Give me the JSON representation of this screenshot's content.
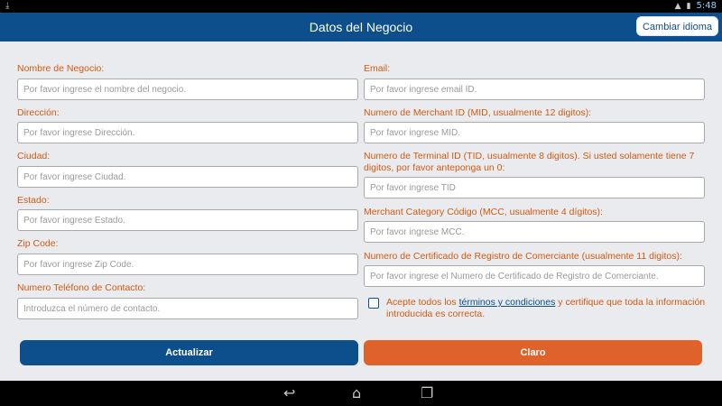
{
  "status_bar": {
    "download_icon": "download-icon",
    "time": "5:48",
    "signal_icon": "signal-icon",
    "battery_icon": "battery-icon"
  },
  "app_bar": {
    "title": "Datos del Negocio",
    "language_button": "Cambiar idioma"
  },
  "form": {
    "left": [
      {
        "label": "Nombre de Negocio:",
        "placeholder": "Por favor ingrese el nombre del negocio.",
        "value": ""
      },
      {
        "label": "Dirección:",
        "placeholder": "Por favor ingrese Dirección.",
        "value": ""
      },
      {
        "label": "Ciudad:",
        "placeholder": "Por favor ingrese Ciudad.",
        "value": ""
      },
      {
        "label": "Estado:",
        "placeholder": "Por favor ingrese Estado.",
        "value": ""
      },
      {
        "label": "Zip Code:",
        "placeholder": "Por favor ingrese Zip Code.",
        "value": ""
      },
      {
        "label": "Numero Teléfono de Contacto:",
        "placeholder": "Introduzca el número de contacto.",
        "value": ""
      }
    ],
    "right": [
      {
        "label": "Email:",
        "placeholder": "Por favor ingrese email ID.",
        "value": ""
      },
      {
        "label": "Numero de Merchant ID (MID, usualmente 12 digitos):",
        "placeholder": "Por favor ingrese MID.",
        "value": ""
      },
      {
        "label": "Numero de Terminal ID (TID, usualmente 8 digitos). Si usted solamente tiene 7 digitos, por favor anteponga un 0:",
        "placeholder": "Por favor ingrese TID",
        "value": ""
      },
      {
        "label": "Merchant Category Código (MCC, usualmente 4 dígitos):",
        "placeholder": "Por favor ingrese MCC.",
        "value": ""
      },
      {
        "label": "Numero de Certificado de Registro de Comerciante (usualmente 11 digitos):",
        "placeholder": "Por favor ingrese el Numero de Certificado de Registro de Comerciante.",
        "value": ""
      }
    ],
    "terms": {
      "checked": false,
      "prefix": "Acepte todos los ",
      "link": "términos y condiciones",
      "suffix": " y certifique que toda la información introducida es correcta."
    }
  },
  "buttons": {
    "update": "Actualizar",
    "clear": "Claro"
  },
  "nav_bar": {
    "back_icon": "back-icon",
    "home_icon": "home-icon",
    "recents_icon": "recents-icon"
  },
  "colors": {
    "primary": "#0c4f8c",
    "accent": "#e0622b",
    "label": "#d25a12",
    "background": "#e9ebee"
  }
}
